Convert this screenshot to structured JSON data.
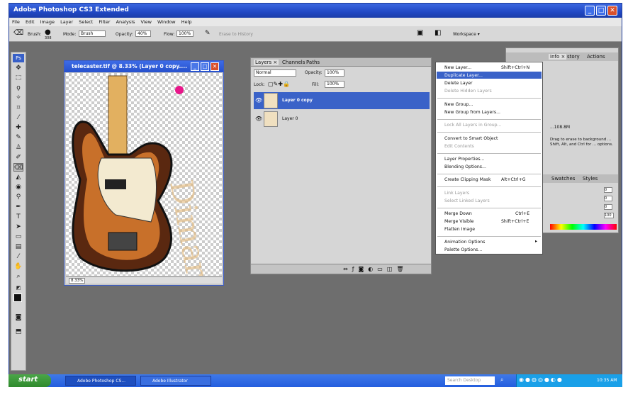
{
  "app": {
    "title": "Adobe Photoshop CS3 Extended"
  },
  "menu": [
    "File",
    "Edit",
    "Image",
    "Layer",
    "Select",
    "Filter",
    "Analysis",
    "View",
    "Window",
    "Help"
  ],
  "options": {
    "brush_label": "Brush:",
    "brush_size": "308",
    "mode_label": "Mode:",
    "mode_value": "Brush",
    "opacity_label": "Opacity:",
    "opacity_value": "40%",
    "flow_label": "Flow:",
    "flow_value": "100%",
    "erase_history": "Erase to History",
    "workspace": "Workspace ▾"
  },
  "document": {
    "title": "telecaster.tif @ 8.33% (Layer 0 copy....",
    "zoom": "8.33%"
  },
  "layers_panel": {
    "tabs": [
      "Layers ×",
      "Channels",
      "Paths"
    ],
    "blend_mode": "Normal",
    "opacity_label": "Opacity:",
    "opacity": "100%",
    "lock_label": "Lock:",
    "fill_label": "Fill:",
    "fill": "100%",
    "layers": [
      {
        "name": "Layer 0 copy",
        "selected": true
      },
      {
        "name": "Layer 0",
        "selected": false
      }
    ]
  },
  "context_menu": {
    "items": [
      {
        "label": "New Layer...",
        "shortcut": "Shift+Ctrl+N",
        "state": "normal"
      },
      {
        "label": "Duplicate Layer...",
        "shortcut": "",
        "state": "highlighted"
      },
      {
        "label": "Delete Layer",
        "shortcut": "",
        "state": "normal"
      },
      {
        "label": "Delete Hidden Layers",
        "shortcut": "",
        "state": "disabled"
      },
      {
        "label": "New Group...",
        "shortcut": "",
        "state": "normal"
      },
      {
        "label": "New Group from Layers...",
        "shortcut": "",
        "state": "normal"
      },
      {
        "label": "Lock All Layers in Group...",
        "shortcut": "",
        "state": "disabled"
      },
      {
        "label": "Convert to Smart Object",
        "shortcut": "",
        "state": "normal"
      },
      {
        "label": "Edit Contents",
        "shortcut": "",
        "state": "disabled"
      },
      {
        "label": "Layer Properties...",
        "shortcut": "",
        "state": "normal"
      },
      {
        "label": "Blending Options...",
        "shortcut": "",
        "state": "normal"
      },
      {
        "label": "Create Clipping Mask",
        "shortcut": "Alt+Ctrl+G",
        "state": "normal"
      },
      {
        "label": "Link Layers",
        "shortcut": "",
        "state": "disabled"
      },
      {
        "label": "Select Linked Layers",
        "shortcut": "",
        "state": "disabled"
      },
      {
        "label": "Merge Down",
        "shortcut": "Ctrl+E",
        "state": "normal"
      },
      {
        "label": "Merge Visible",
        "shortcut": "Shift+Ctrl+E",
        "state": "normal"
      },
      {
        "label": "Flatten Image",
        "shortcut": "",
        "state": "normal"
      },
      {
        "label": "Animation Options",
        "shortcut": "",
        "state": "normal"
      },
      {
        "label": "Palette Options...",
        "shortcut": "",
        "state": "normal"
      }
    ]
  },
  "right_panel": {
    "tabs": [
      "Info ×",
      "story",
      "Actions"
    ],
    "doc_size": "...108.8M",
    "hint": "Drag to erase to background ... Shift, Alt, and Ctrl for ... options.",
    "swatch_tabs": [
      "Swatches",
      "Styles"
    ],
    "values": [
      "0",
      "0",
      "0",
      "100"
    ]
  },
  "taskbar": {
    "start": "start",
    "tasks": [
      "Adobe Photoshop CS...",
      "Adobe Illustrator"
    ],
    "search": "Search Desktop",
    "clock": "10:35 AM"
  }
}
